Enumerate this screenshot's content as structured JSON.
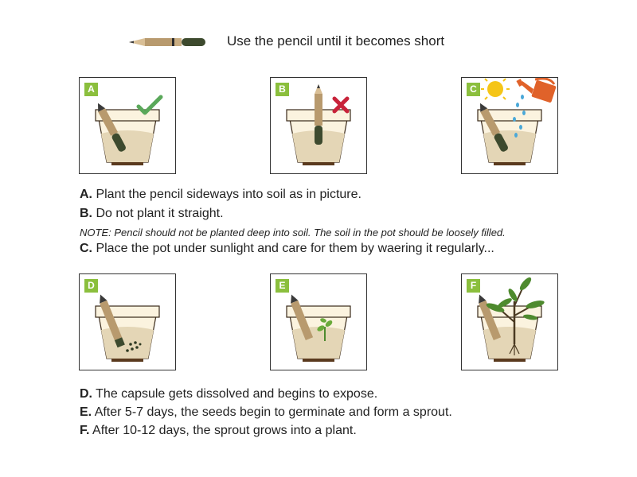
{
  "header": {
    "text": "Use the pencil until it becomes short",
    "icon": "short-pencil-icon"
  },
  "panels_top": [
    {
      "badge": "A",
      "status_icon": "green-check-icon",
      "illustration": "pencil-planted-sideways"
    },
    {
      "badge": "B",
      "status_icon": "red-x-icon",
      "illustration": "pencil-planted-straight"
    },
    {
      "badge": "C",
      "status_icon": "sun-and-watering-can-icon",
      "illustration": "pot-under-sun-watered"
    }
  ],
  "captions_top": {
    "a_letter": "A.",
    "a_text": "Plant the pencil sideways into soil as in picture.",
    "b_letter": "B.",
    "b_text": "Do not plant it straight.",
    "note": "NOTE: Pencil should not be planted deep into soil. The soil in the pot should be loosely filled.",
    "c_letter": "C.",
    "c_text": "Place the pot under sunlight and care for them by waering it regularly..."
  },
  "panels_bottom": [
    {
      "badge": "D",
      "illustration": "capsule-dissolving-seeds"
    },
    {
      "badge": "E",
      "illustration": "small-sprout"
    },
    {
      "badge": "F",
      "illustration": "grown-plant"
    }
  ],
  "captions_bottom": {
    "d_letter": "D.",
    "d_text": "The capsule gets dissolved and begins to expose.",
    "e_letter": "E.",
    "e_text": "After 5-7 days, the seeds begin to germinate and form a sprout.",
    "f_letter": "F.",
    "f_text": "After 10-12 days, the sprout grows into a plant."
  },
  "colors": {
    "badge_green": "#8bbf3d",
    "pot_rim": "#fbf3df",
    "soil": "#e4d6b6",
    "pot_base": "#5a3a1e",
    "pencil_wood": "#b89a6e",
    "pencil_capsule": "#3d4a2e",
    "check_green": "#5aa85a",
    "x_red": "#c8233a",
    "sun_yellow": "#f5c518",
    "can_orange": "#e0622a",
    "water_blue": "#4aa8d8",
    "leaf_green": "#4e8a2e"
  }
}
